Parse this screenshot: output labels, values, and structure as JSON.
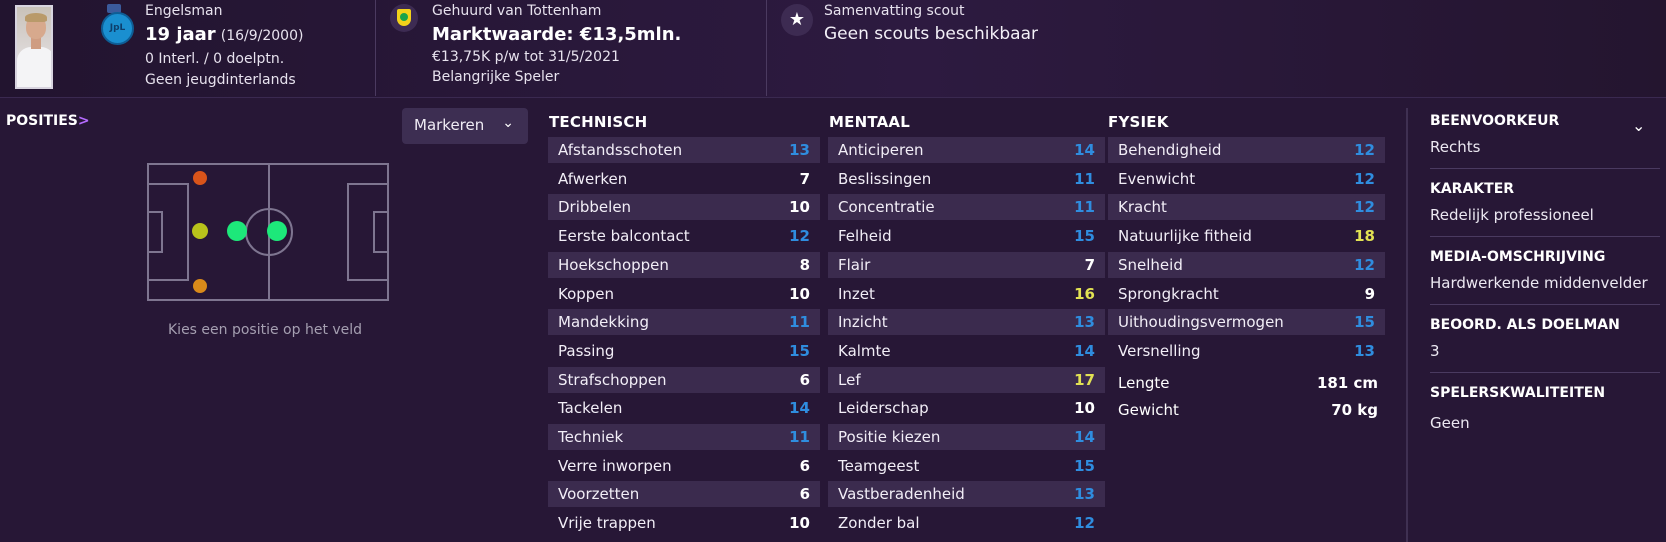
{
  "player": {
    "nationality": "Engelsman",
    "age": "19 jaar",
    "dob": "(16/9/2000)",
    "caps": "0 Interl. / 0 doelptn.",
    "youth_caps": "Geen jeugdinterlands",
    "flag_text": "JpL"
  },
  "contract": {
    "loan": "Gehuurd van Tottenham",
    "value": "Marktwaarde: €13,5mln.",
    "wage": "€13,75K p/w tot 31/5/2021",
    "status": "Belangrijke Speler"
  },
  "scout": {
    "title": "Samenvatting scout",
    "text": "Geen scouts beschikbaar",
    "icon": "star-icon"
  },
  "positions": {
    "title": "POSITIES",
    "chevron": ">",
    "dropdown_label": "Markeren",
    "hint": "Kies een positie op het veld",
    "colors": {
      "natural": "#1de87a",
      "accomplished": "#b8c21b",
      "unconvincing": "#d98a1a",
      "awkward": "#d9541a"
    }
  },
  "technisch": {
    "title": "TECHNISCH",
    "rows": [
      {
        "label": "Afstandsschoten",
        "value": "13",
        "tone": "b"
      },
      {
        "label": "Afwerken",
        "value": "7",
        "tone": "w"
      },
      {
        "label": "Dribbelen",
        "value": "10",
        "tone": "w"
      },
      {
        "label": "Eerste balcontact",
        "value": "12",
        "tone": "b"
      },
      {
        "label": "Hoekschoppen",
        "value": "8",
        "tone": "w"
      },
      {
        "label": "Koppen",
        "value": "10",
        "tone": "w"
      },
      {
        "label": "Mandekking",
        "value": "11",
        "tone": "b"
      },
      {
        "label": "Passing",
        "value": "15",
        "tone": "b"
      },
      {
        "label": "Strafschoppen",
        "value": "6",
        "tone": "w"
      },
      {
        "label": "Tackelen",
        "value": "14",
        "tone": "b"
      },
      {
        "label": "Techniek",
        "value": "11",
        "tone": "b"
      },
      {
        "label": "Verre inworpen",
        "value": "6",
        "tone": "w"
      },
      {
        "label": "Voorzetten",
        "value": "6",
        "tone": "w"
      },
      {
        "label": "Vrije trappen",
        "value": "10",
        "tone": "w"
      }
    ]
  },
  "mentaal": {
    "title": "MENTAAL",
    "rows": [
      {
        "label": "Anticiperen",
        "value": "14",
        "tone": "b"
      },
      {
        "label": "Beslissingen",
        "value": "11",
        "tone": "b"
      },
      {
        "label": "Concentratie",
        "value": "11",
        "tone": "b"
      },
      {
        "label": "Felheid",
        "value": "15",
        "tone": "b"
      },
      {
        "label": "Flair",
        "value": "7",
        "tone": "w"
      },
      {
        "label": "Inzet",
        "value": "16",
        "tone": "y"
      },
      {
        "label": "Inzicht",
        "value": "13",
        "tone": "b"
      },
      {
        "label": "Kalmte",
        "value": "14",
        "tone": "b"
      },
      {
        "label": "Lef",
        "value": "17",
        "tone": "y"
      },
      {
        "label": "Leiderschap",
        "value": "10",
        "tone": "w"
      },
      {
        "label": "Positie kiezen",
        "value": "14",
        "tone": "b"
      },
      {
        "label": "Teamgeest",
        "value": "15",
        "tone": "b"
      },
      {
        "label": "Vastberadenheid",
        "value": "13",
        "tone": "b"
      },
      {
        "label": "Zonder bal",
        "value": "12",
        "tone": "b"
      }
    ]
  },
  "fysiek": {
    "title": "FYSIEK",
    "rows": [
      {
        "label": "Behendigheid",
        "value": "12",
        "tone": "b"
      },
      {
        "label": "Evenwicht",
        "value": "12",
        "tone": "b"
      },
      {
        "label": "Kracht",
        "value": "12",
        "tone": "b"
      },
      {
        "label": "Natuurlijke fitheid",
        "value": "18",
        "tone": "y"
      },
      {
        "label": "Snelheid",
        "value": "12",
        "tone": "b"
      },
      {
        "label": "Sprongkracht",
        "value": "9",
        "tone": "w"
      },
      {
        "label": "Uithoudingsvermogen",
        "value": "15",
        "tone": "b"
      },
      {
        "label": "Versnelling",
        "value": "13",
        "tone": "b"
      }
    ],
    "height_label": "Lengte",
    "height_value": "181 cm",
    "weight_label": "Gewicht",
    "weight_value": "70 kg"
  },
  "info": {
    "foot_title": "BEENVOORKEUR",
    "foot_value": "Rechts",
    "character_title": "KARAKTER",
    "character_value": "Redelijk professioneel",
    "media_title": "MEDIA-OMSCHRIJVING",
    "media_value": "Hardwerkende middenvelder",
    "gk_title": "BEOORD. ALS DOELMAN",
    "gk_value": "3",
    "traits_title": "SPELERSKWALITEITEN",
    "traits_value": "Geen"
  },
  "colors": {
    "background": "#271736",
    "row": "#3b2b4e",
    "blue": "#2f8ddf",
    "yellow": "#e2e253",
    "white": "#ffffff"
  }
}
